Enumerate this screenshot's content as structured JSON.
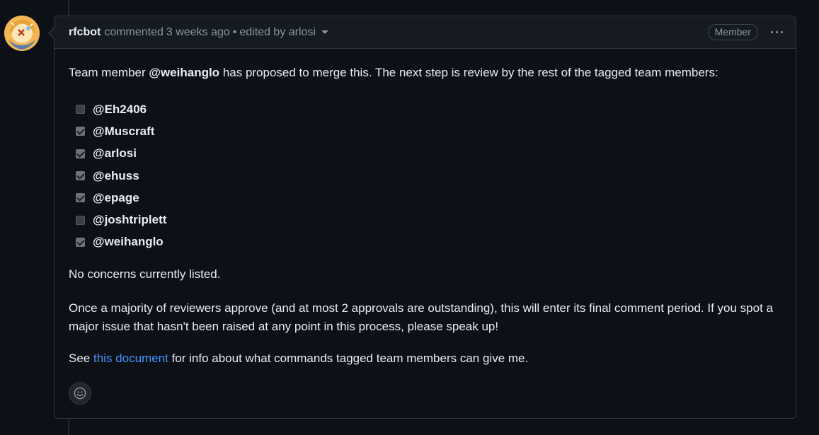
{
  "comment": {
    "author": "rfcbot",
    "action": "commented",
    "time": "3 weeks ago",
    "separator": "•",
    "edited_by": "edited by arlosi",
    "badge": "Member",
    "more_icon": "kebab-horizontal-icon",
    "avatar_icon": "user-avatar"
  },
  "body": {
    "intro_prefix": "Team member",
    "intro_mention": "@weihanglo",
    "intro_suffix": "has proposed to merge this. The next step is review by the rest of the tagged team members:",
    "reviewers": [
      {
        "name": "@Eh2406",
        "checked": false
      },
      {
        "name": "@Muscraft",
        "checked": true
      },
      {
        "name": "@arlosi",
        "checked": true
      },
      {
        "name": "@ehuss",
        "checked": true
      },
      {
        "name": "@epage",
        "checked": true
      },
      {
        "name": "@joshtriplett",
        "checked": false
      },
      {
        "name": "@weihanglo",
        "checked": true
      }
    ],
    "concerns": "No concerns currently listed.",
    "approval_text": "Once a majority of reviewers approve (and at most 2 approvals are outstanding), this will enter its final comment period. If you spot a major issue that hasn't been raised at any point in this process, please speak up!",
    "see_prefix": "See",
    "see_link": "this document",
    "see_suffix": "for info about what commands tagged team members can give me."
  },
  "reaction": {
    "icon": "smiley-icon"
  },
  "colors": {
    "background": "#0d1117",
    "header_bg": "#161b22",
    "border": "#30363d",
    "text": "#e6edf3",
    "muted": "#8b949e",
    "link": "#4493f8"
  }
}
